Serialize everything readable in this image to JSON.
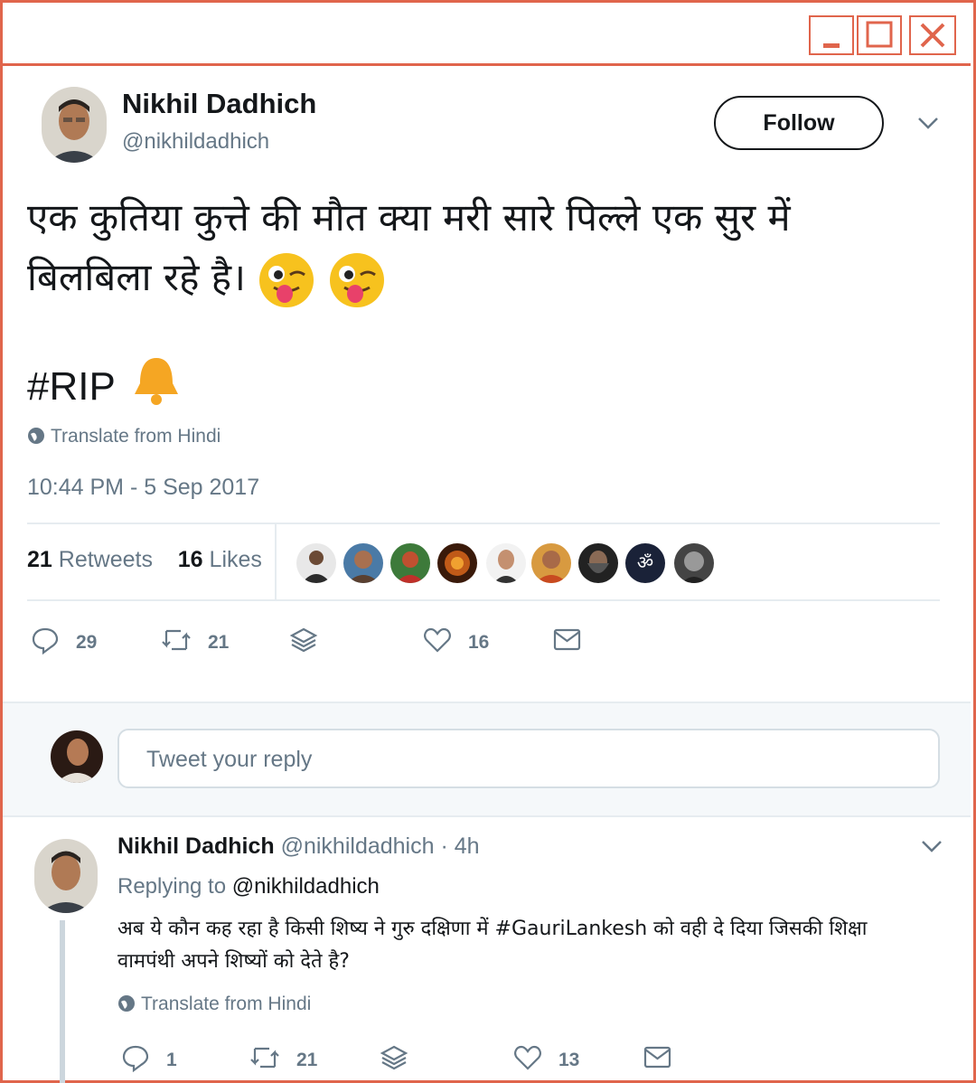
{
  "window": {
    "controls": [
      "minimize-icon",
      "maximize-icon",
      "close-icon"
    ]
  },
  "tweet": {
    "author_name": "Nikhil Dadhich",
    "author_handle": "@nikhildadhich",
    "follow_label": "Follow",
    "text_line1": "एक कुतिया कुत्ते की मौत क्या मरी सारे पिल्ले एक सुर में",
    "text_line2": "बिलबिला रहे है। ",
    "emoji": "winking-face-with-tongue",
    "hashtag": "#RIP",
    "hashtag_emoji": "bell",
    "translate_label": "Translate from Hindi",
    "timestamp": "10:44 PM - 5 Sep 2017",
    "retweets_count": "21",
    "retweets_label": "Retweets",
    "likes_count": "16",
    "likes_label": "Likes",
    "actions": {
      "reply_count": "29",
      "retweet_count": "21",
      "like_count": "16"
    }
  },
  "reply_box": {
    "placeholder": "Tweet your reply"
  },
  "reply": {
    "author_name": "Nikhil Dadhich",
    "author_handle": "@nikhildadhich",
    "time": "· 4h",
    "replying_prefix": "Replying to",
    "replying_to": "@nikhildadhich",
    "text_line1": "अब ये कौन कह रहा है किसी शिष्य ने गुरु दक्षिणा में #GauriLankesh को वही दे दिया जिसकी शिक्षा",
    "text_line2": "वामपंथी अपने शिष्यों को देते है?",
    "translate_label": "Translate from Hindi",
    "actions": {
      "reply_count": "1",
      "retweet_count": "21",
      "like_count": "13"
    }
  },
  "colors": {
    "frame": "#e0654c",
    "secondary_text": "#657786",
    "primary_text": "#14171a"
  }
}
